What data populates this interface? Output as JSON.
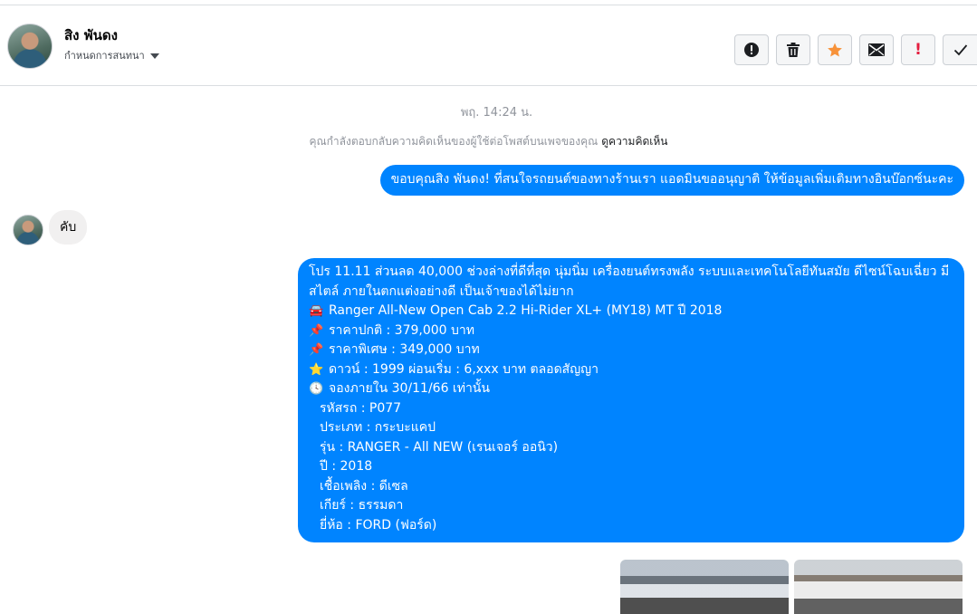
{
  "header": {
    "user_name": "สิง พันดง",
    "assign_label": "กำหนดการสนทนา",
    "toolbar": [
      {
        "name": "report-button",
        "icon": "alert-circle-icon",
        "glyph": "⓿"
      },
      {
        "name": "delete-button",
        "icon": "trash-icon",
        "glyph": "🗑"
      },
      {
        "name": "star-button",
        "icon": "star-icon",
        "glyph": "★"
      },
      {
        "name": "mark-unread-button",
        "icon": "envelope-icon",
        "glyph": "✉"
      },
      {
        "name": "spam-button",
        "icon": "exclamation-icon",
        "glyph": "!"
      },
      {
        "name": "done-button",
        "icon": "check-icon",
        "glyph": "✓"
      }
    ]
  },
  "chat": {
    "timestamp": "พฤ. 14:24 น.",
    "reply_note": "คุณกำลังตอบกลับความคิดเห็นของผู้ใช้ต่อโพสต์บนเพจของคุณ",
    "reply_link": "ดูความคิดเห็น",
    "msg_out_1": "ขอบคุณสิง พันดง! ที่สนใจรถยนต์ของทางร้านเรา แอดมินขออนุญาติ ให้ข้อมูลเพิ่มเติมทางอินบ๊อกซ์นะคะ",
    "msg_in_1": "คับ",
    "promo": {
      "intro": "โปร 11.11 ส่วนลด 40,000 ช่วงล่างที่ดีที่สุด นุ่มนิ่ม เครื่องยนต์ทรงพลัง ระบบและเทคโนโลยีทันสมัย ดีไซน์โฉบเฉี่ยว มีสไตล์ ภายในตกแต่งอย่างดี เป็นเจ้าของได้ไม่ยาก",
      "model": "Ranger All-New Open Cab 2.2 Hi-Rider XL+ (MY18) MT ปี 2018",
      "normal_price": "ราคาปกติ : 379,000 บาท",
      "special_price": "ราคาพิเศษ : 349,000 บาท",
      "down": "ดาวน์ : 1999 ผ่อนเริ่ม : 6,xxx บาท ตลอดสัญญา",
      "deadline": "จองภายใน 30/11/66 เท่านั้น",
      "car_code": "รหัสรถ : P077",
      "type": "ประเภท : กระบะแคป",
      "series": "รุ่น : RANGER - All NEW (เรนเจอร์ ออนิว)",
      "year": "ปี : 2018",
      "fuel": "เชื้อเพลิง : ดีเซล",
      "gear": "เกียร์ : ธรรมดา",
      "brand": "ยี่ห้อ : FORD (ฟอร์ด)"
    },
    "icons": {
      "car": "🚘",
      "pin": "📌",
      "star": "⭐",
      "clock": "🕓"
    }
  }
}
